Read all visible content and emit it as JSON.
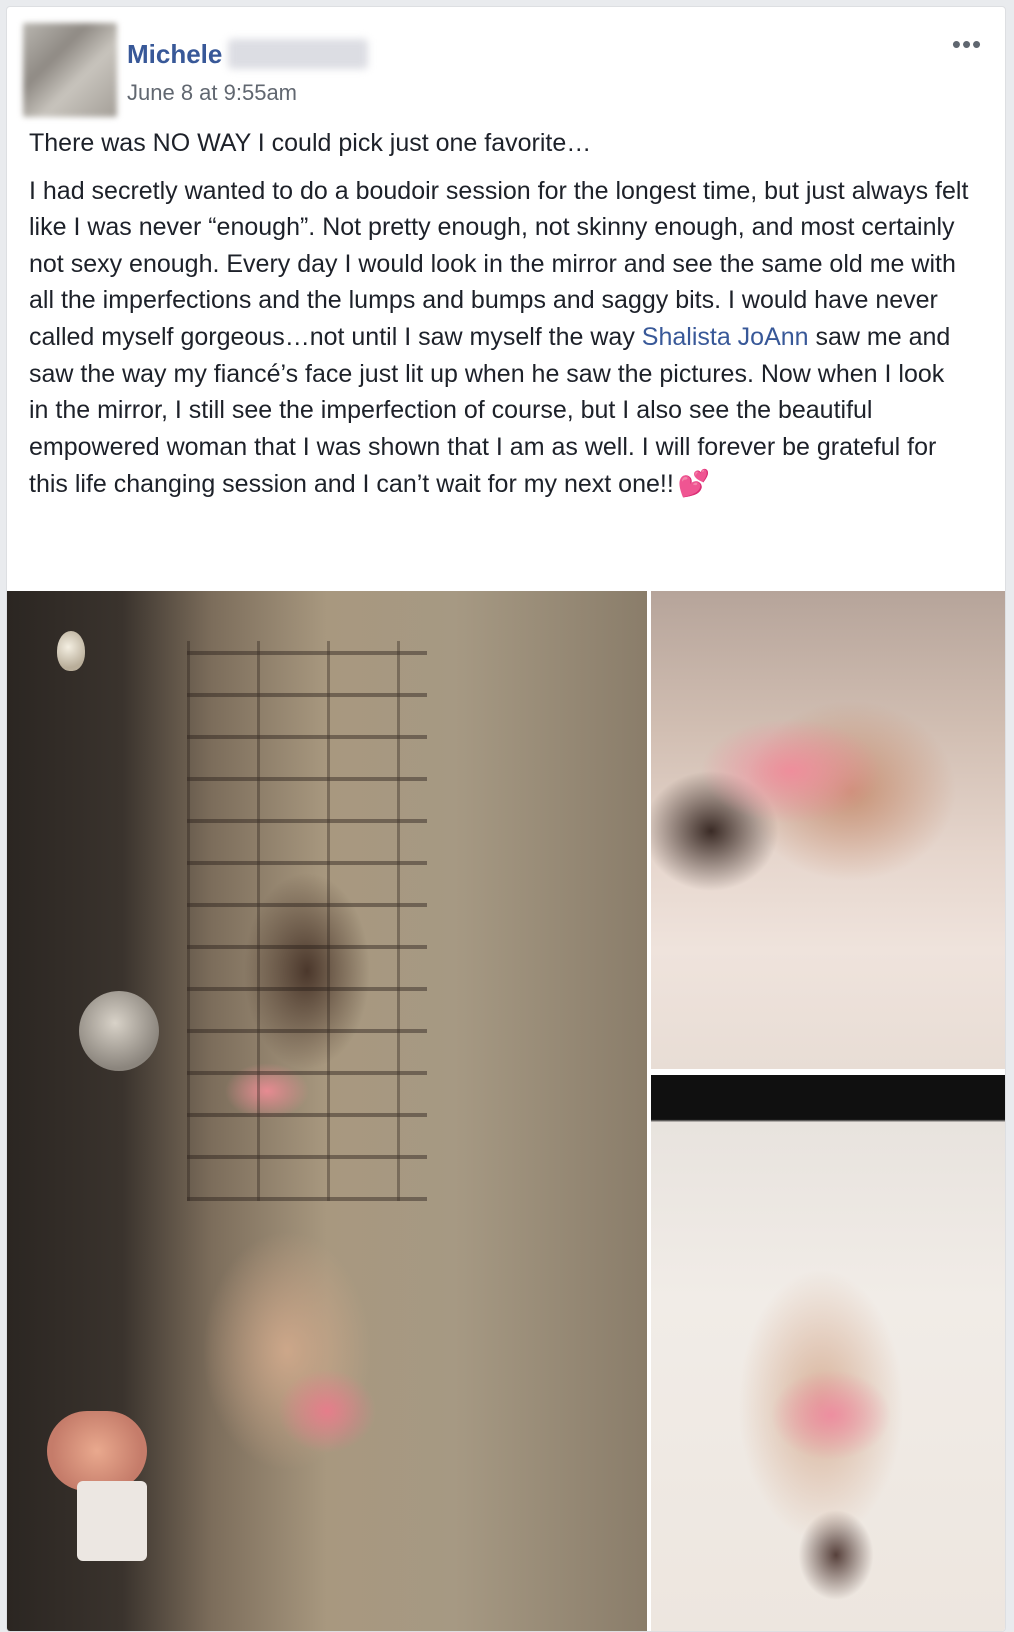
{
  "post": {
    "author": {
      "first_name": "Michele"
    },
    "timestamp": "June 8 at 9:55am",
    "more_options_icon": "more-options-icon",
    "paragraph_1": "There was NO WAY I could pick just one favorite…",
    "paragraph_2_part_1": "I had secretly wanted to do a boudoir session for the longest time, but just always felt like I was never “enough”. Not pretty enough, not skinny enough, and most certainly not sexy enough. Every day I would look in the mirror and see the same old me with all the imperfections and the lumps and bumps and saggy bits. I would have never called myself gorgeous…not until I saw myself the way ",
    "mention": "Shalista JoAnn",
    "paragraph_2_part_2": " saw me and saw the way my fiancé’s face just lit up when he saw the pictures. Now when I look in the mirror, I still see the imperfection of course, but I also see the beautiful empowered woman that I was shown that I am as well. I will forever be grateful for this life changing session and I can’t wait for my next one!!",
    "emoji": "💕",
    "emoji_icon": "two-hearts-icon"
  },
  "colors": {
    "link": "#385898",
    "text": "#1d2129",
    "meta": "#616770",
    "background": "#e9ebee",
    "card": "#ffffff"
  }
}
